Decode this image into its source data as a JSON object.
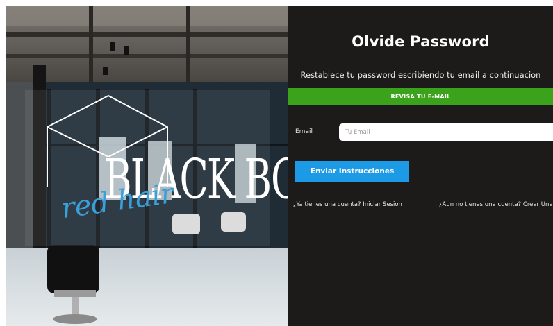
{
  "brand": {
    "logo_line1": "BLACK BOX",
    "logo_line2": "red hair"
  },
  "form": {
    "title": "Olvide Password",
    "subtitle": "Restablece tu password escribiendo tu email a continuacion",
    "alert_text": "REVISA TU E-MAIL",
    "email_label": "Email",
    "email_placeholder": "Tu Email",
    "email_value": "",
    "submit_label": "Enviar Instrucciones"
  },
  "links": {
    "login": "¿Ya tienes una cuenta? Iniciar Sesion",
    "register": "¿Aun no tienes una cuenta? Crear Una"
  },
  "colors": {
    "panel_bg": "#1c1b19",
    "alert_green": "#3ba21b",
    "button_blue": "#1c9ae6",
    "logo_script": "#3aa0dc"
  }
}
